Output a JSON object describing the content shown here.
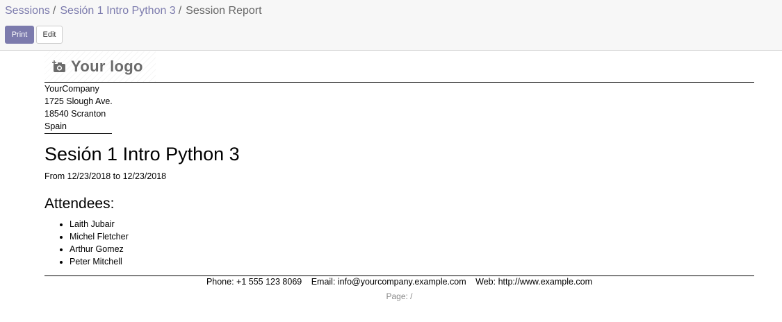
{
  "breadcrumb": {
    "items": [
      "Sessions",
      "Sesión 1 Intro Python 3"
    ],
    "current": "Session Report",
    "separator": "/"
  },
  "toolbar": {
    "print_label": "Print",
    "edit_label": "Edit"
  },
  "report": {
    "logo_text": "Your logo",
    "company": {
      "name": "YourCompany",
      "street": "1725 Slough Ave.",
      "city": "18540 Scranton",
      "country": "Spain"
    },
    "title": "Sesión 1 Intro Python 3",
    "dates": "From 12/23/2018 to 12/23/2018",
    "attendees_heading": "Attendees:",
    "attendees": [
      "Laith Jubair",
      "Michel Fletcher",
      "Arthur Gomez",
      "Peter Mitchell"
    ],
    "footer": {
      "phone": "Phone: +1 555 123 8069",
      "email": "Email: info@yourcompany.example.com",
      "web": "Web: http://www.example.com",
      "page": "Page: /"
    }
  },
  "colors": {
    "accent": "#7c7bad",
    "control_panel_bg": "#f7f7f7",
    "muted_text": "#666666"
  },
  "icons": {
    "logo": "camera-plus-icon"
  }
}
